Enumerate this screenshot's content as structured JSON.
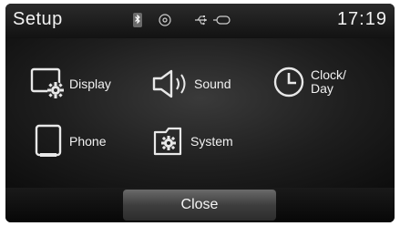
{
  "status_bar": {
    "title": "Setup",
    "time": "17:19",
    "icons": [
      "bluetooth-icon",
      "disc-icon",
      "usb-icon",
      "aux-icon"
    ]
  },
  "menu": {
    "items": [
      {
        "label": "Display",
        "icon": "display-icon"
      },
      {
        "label": "Sound",
        "icon": "sound-icon"
      },
      {
        "label_line1": "Clock/",
        "label_line2": "Day",
        "icon": "clock-icon"
      },
      {
        "label": "Phone",
        "icon": "phone-icon"
      },
      {
        "label": "System",
        "icon": "system-icon"
      }
    ]
  },
  "footer": {
    "close_label": "Close"
  }
}
